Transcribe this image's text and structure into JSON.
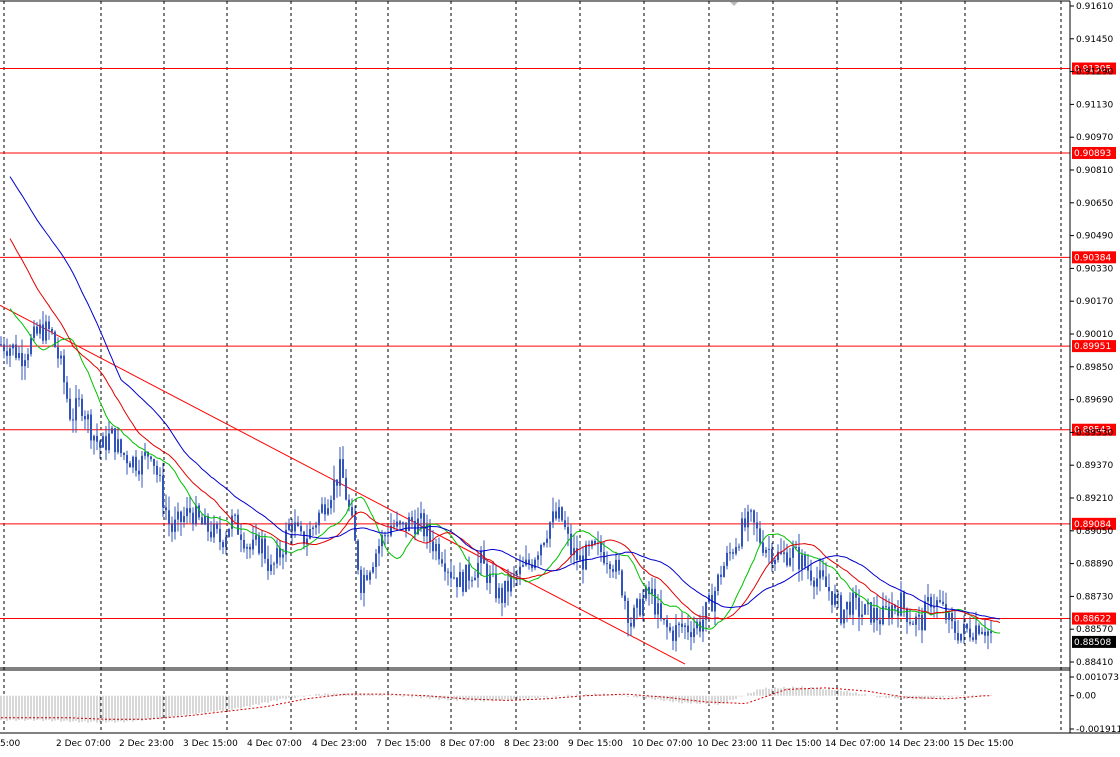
{
  "chart_data": {
    "type": "candlestick",
    "main_panel": {
      "price_range": [
        0.8841,
        0.9161
      ],
      "price_ticks": [
        "0.91610",
        "0.91450",
        "0.91290",
        "0.91130",
        "0.90970",
        "0.90810",
        "0.90650",
        "0.90490",
        "0.90330",
        "0.90170",
        "0.90010",
        "0.89850",
        "0.89690",
        "0.89530",
        "0.89370",
        "0.89210",
        "0.89050",
        "0.88890",
        "0.88730",
        "0.88570",
        "0.88410"
      ],
      "horizontal_levels": [
        {
          "label": "0.91305",
          "value": 0.91305
        },
        {
          "label": "0.90893",
          "value": 0.90893
        },
        {
          "label": "0.90384",
          "value": 0.90384
        },
        {
          "label": "0.89951",
          "value": 0.89951
        },
        {
          "label": "0.89543",
          "value": 0.89543
        },
        {
          "label": "0.89084",
          "value": 0.89084
        },
        {
          "label": "0.88622",
          "value": 0.88622
        }
      ],
      "current_price": {
        "label": "0.88508",
        "value": 0.88508
      },
      "trendline": {
        "from": [
          0,
          0.9015
        ],
        "to": [
          685,
          0.884
        ]
      },
      "price_path_x": [
        0,
        10,
        20,
        30,
        40,
        50,
        60,
        70,
        80,
        90,
        100,
        110,
        120,
        130,
        140,
        150,
        160,
        170,
        180,
        190,
        200,
        210,
        220,
        230,
        240,
        250,
        260,
        270,
        280,
        290,
        300,
        310,
        320,
        330,
        340,
        350,
        360,
        370,
        380,
        390,
        400,
        410,
        420,
        430,
        440,
        450,
        460,
        470,
        480,
        490,
        500,
        510,
        520,
        530,
        540,
        550,
        560,
        570,
        580,
        590,
        600,
        610,
        620,
        630,
        640,
        650,
        660,
        670,
        680,
        690,
        700,
        710,
        720,
        730,
        740,
        750,
        760,
        770,
        780,
        790,
        800,
        810,
        820,
        830,
        840,
        850,
        860,
        870,
        880,
        890,
        900,
        910,
        920,
        930,
        940,
        950,
        960,
        970,
        980,
        990
      ],
      "price_path_y": [
        0.8996,
        0.8995,
        0.899,
        0.8997,
        0.9003,
        0.9002,
        0.8985,
        0.896,
        0.8968,
        0.8955,
        0.8945,
        0.8952,
        0.8943,
        0.894,
        0.8938,
        0.8945,
        0.8925,
        0.8905,
        0.891,
        0.8915,
        0.8908,
        0.8905,
        0.89,
        0.891,
        0.8905,
        0.8895,
        0.89,
        0.8885,
        0.8895,
        0.891,
        0.89,
        0.8905,
        0.8915,
        0.8925,
        0.8935,
        0.891,
        0.888,
        0.889,
        0.89,
        0.8908,
        0.8905,
        0.891,
        0.8908,
        0.89,
        0.8895,
        0.8885,
        0.888,
        0.8885,
        0.889,
        0.888,
        0.8872,
        0.888,
        0.8885,
        0.889,
        0.89,
        0.891,
        0.8912,
        0.8895,
        0.889,
        0.8895,
        0.8895,
        0.8892,
        0.888,
        0.886,
        0.887,
        0.8875,
        0.886,
        0.8855,
        0.8858,
        0.8858,
        0.886,
        0.887,
        0.8885,
        0.8895,
        0.8905,
        0.891,
        0.89,
        0.8895,
        0.8892,
        0.8895,
        0.889,
        0.8885,
        0.888,
        0.8875,
        0.8865,
        0.887,
        0.8865,
        0.8865,
        0.8862,
        0.8868,
        0.887,
        0.8862,
        0.886,
        0.8872,
        0.8868,
        0.8858,
        0.8855,
        0.8857,
        0.886,
        0.8854
      ]
    },
    "sub_panel": {
      "range": [
        -0.001911,
        0.001073
      ],
      "ticks": [
        "0.001073",
        "0.00",
        "-0.001911"
      ],
      "histogram_x": [
        0,
        40,
        80,
        120,
        160,
        200,
        240,
        280,
        320,
        360,
        400,
        440,
        480,
        520,
        560,
        600,
        640,
        680,
        720,
        760,
        800,
        840,
        880,
        920,
        960,
        990
      ],
      "histogram_values": [
        -0.0014,
        -0.0014,
        -0.0015,
        -0.0015,
        -0.0013,
        -0.001,
        -0.0007,
        -0.0002,
        0.0001,
        0.0001,
        0.0,
        -0.0002,
        -0.0003,
        -0.0002,
        0.0,
        0.0001,
        -0.0001,
        -0.0004,
        -0.0005,
        0.0004,
        0.0005,
        0.0003,
        -0.0001,
        -0.0002,
        0.0,
        0.0
      ]
    },
    "x_axis": {
      "labels": [
        "5:00",
        "2 Dec 07:00",
        "2 Dec 23:00",
        "3 Dec 15:00",
        "4 Dec 07:00",
        "4 Dec 23:00",
        "7 Dec 15:00",
        "8 Dec 07:00",
        "8 Dec 23:00",
        "9 Dec 15:00",
        "10 Dec 07:00",
        "10 Dec 23:00",
        "11 Dec 15:00",
        "14 Dec 07:00",
        "14 Dec 23:00",
        "15 Dec 15:00"
      ]
    },
    "grid": true,
    "colors": {
      "candles": "#3355bb",
      "ma_fast": "#00c000",
      "ma_mid": "#e00000",
      "ma_slow": "#0000cc",
      "levels": "#ff0000",
      "histogram": "#b0b0b0",
      "signal": "#d00000"
    }
  }
}
